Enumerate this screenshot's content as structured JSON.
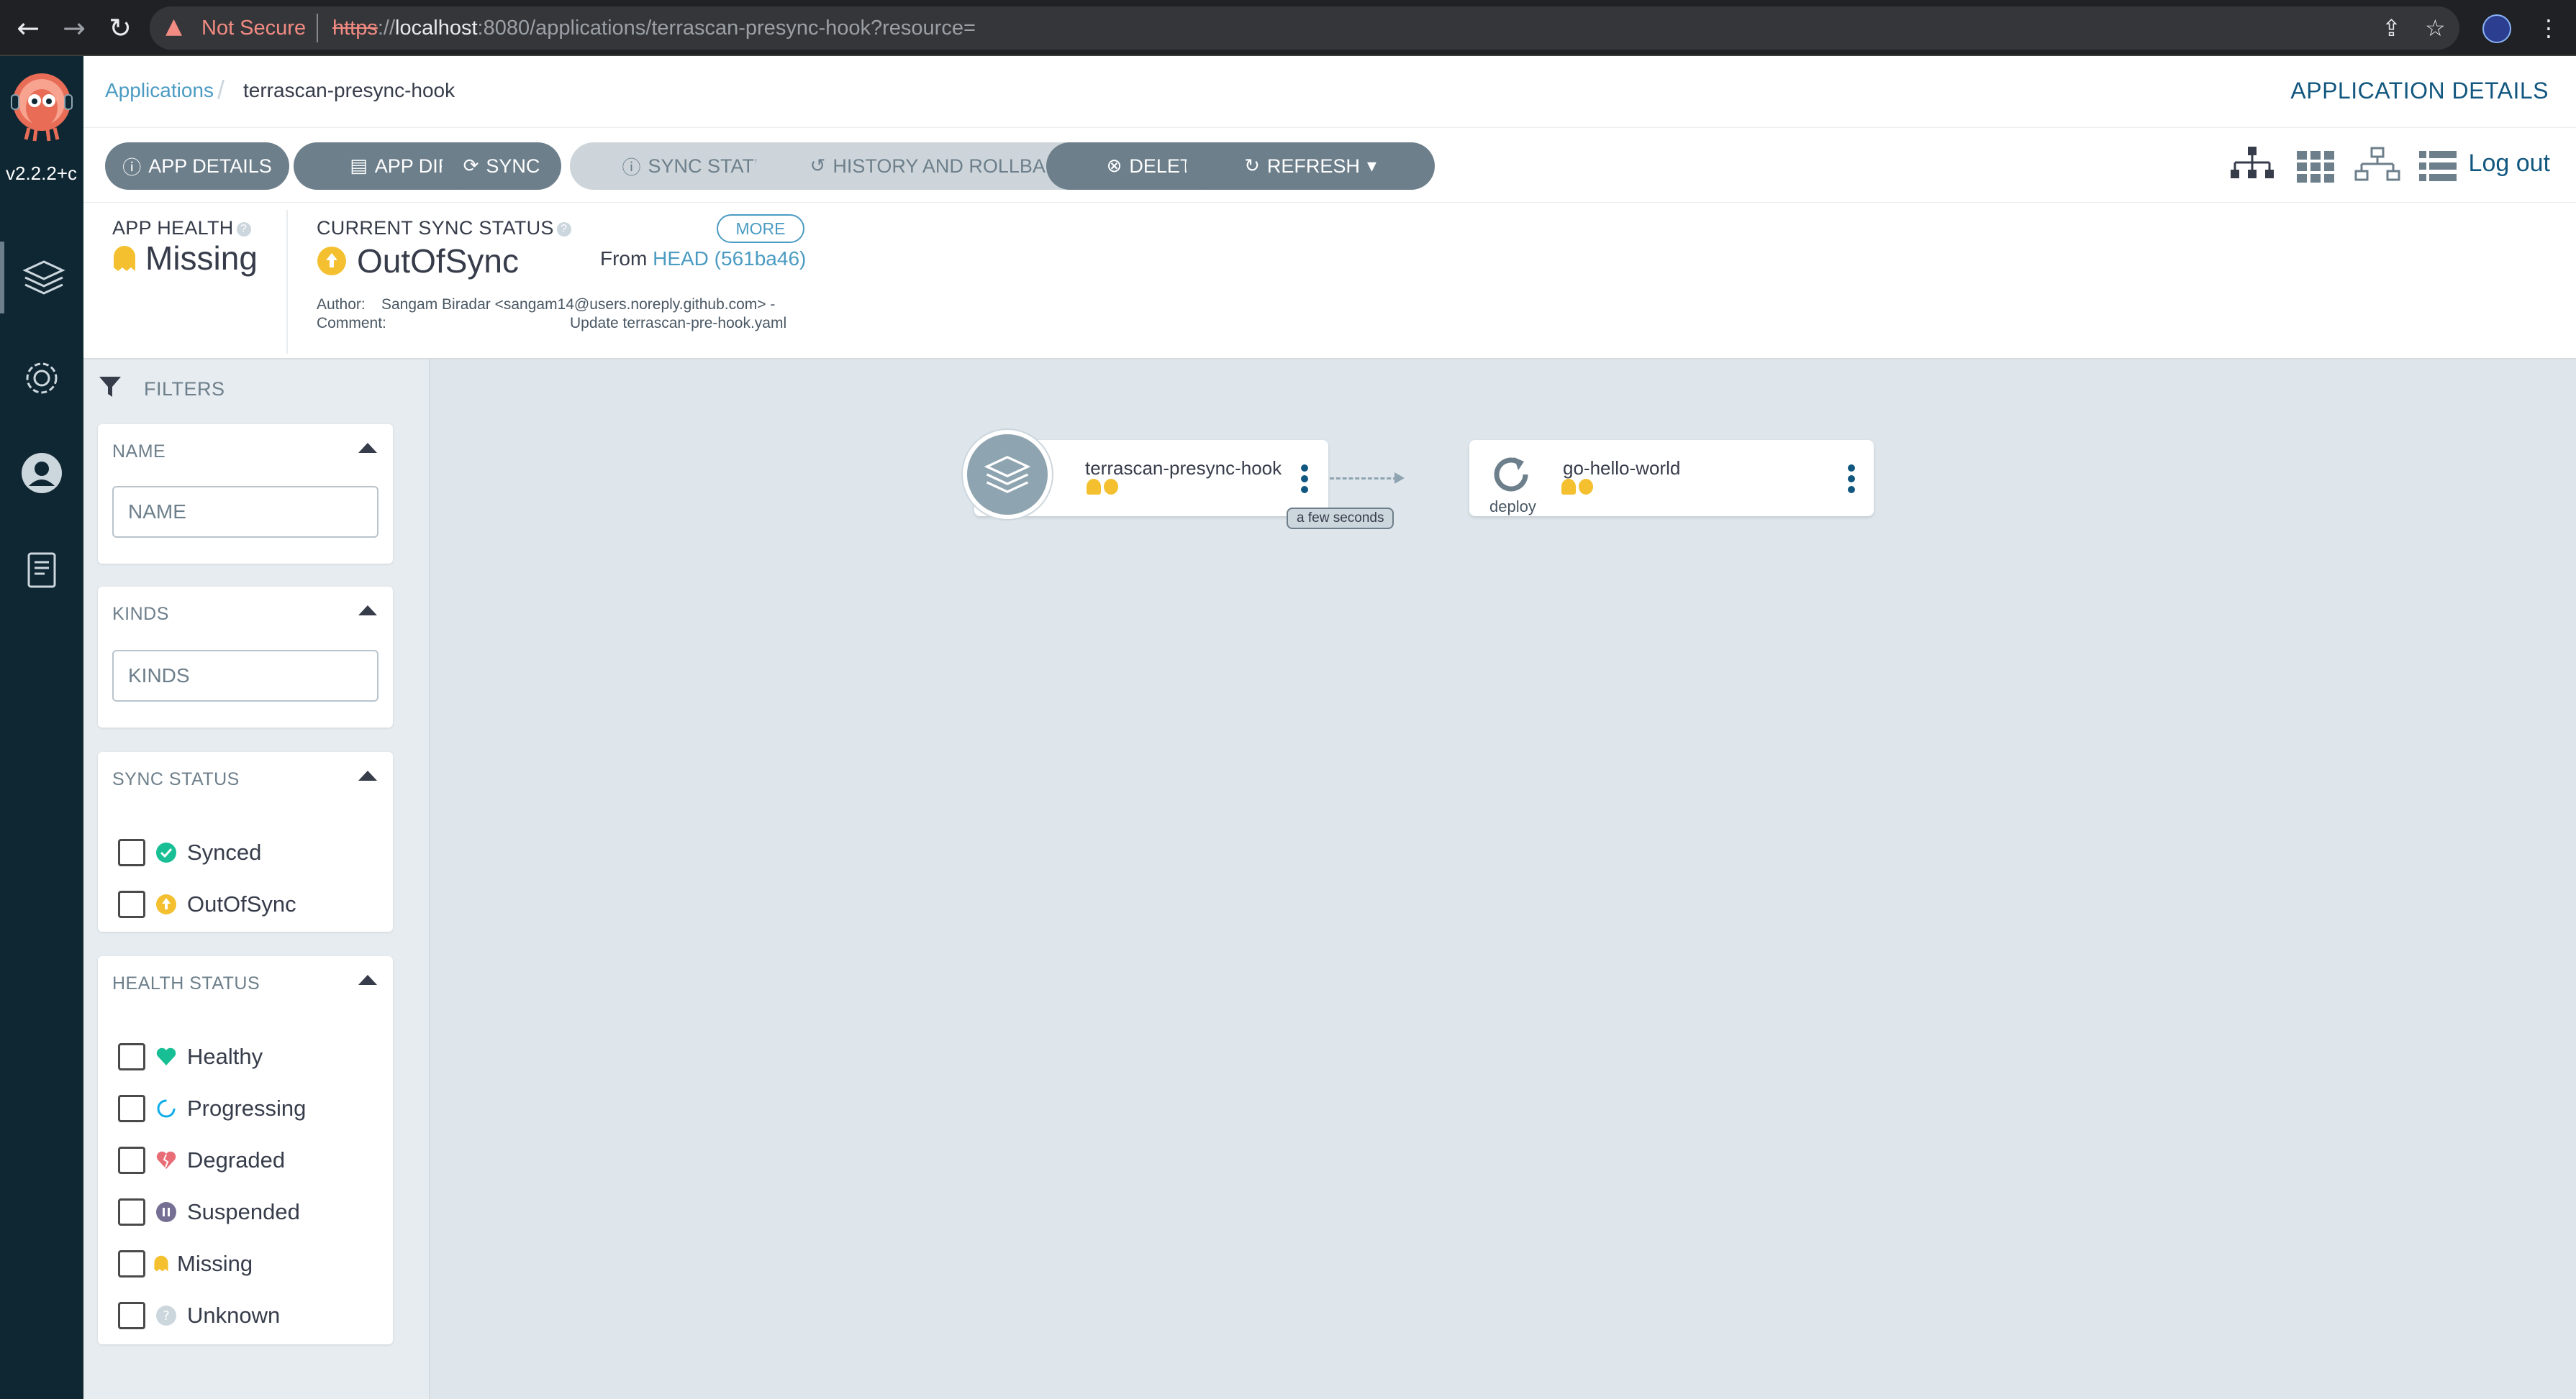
{
  "browser": {
    "not_secure": "Not Secure",
    "url_scheme": "https",
    "url_host": "localhost",
    "url_rest": ":8080/applications/terrascan-presync-hook?resource=",
    "url_sep": "://"
  },
  "nav": {
    "version": "v2.2.2+c",
    "items": [
      "applications-icon",
      "settings-icon",
      "user-info-icon",
      "docs-icon"
    ]
  },
  "header": {
    "breadcrumb_root": "Applications",
    "breadcrumb_current": "terrascan-presync-hook",
    "title": "APPLICATION DETAILS"
  },
  "toolbar": {
    "app_details": "APP DETAILS",
    "app_diff": "APP DIFF",
    "sync": "SYNC",
    "sync_status": "SYNC STATUS",
    "history": "HISTORY AND ROLLBACK",
    "delete": "DELETE",
    "refresh": "REFRESH",
    "logout": "Log out"
  },
  "status": {
    "health_label": "APP HEALTH",
    "health_value": "Missing",
    "sync_label": "CURRENT SYNC STATUS",
    "sync_value": "OutOfSync",
    "more": "MORE",
    "from_prefix": "From",
    "revision": "HEAD (561ba46)",
    "author_label": "Author:",
    "author_value": "Sangam Biradar <sangam14@users.noreply.github.com> -",
    "comment_label": "Comment:",
    "comment_value": "Update terrascan-pre-hook.yaml"
  },
  "filters": {
    "title": "FILTERS",
    "name_title": "NAME",
    "name_placeholder": "NAME",
    "kinds_title": "KINDS",
    "kinds_placeholder": "KINDS",
    "sync_title": "SYNC STATUS",
    "sync_options": [
      "Synced",
      "OutOfSync"
    ],
    "health_title": "HEALTH STATUS",
    "health_options": [
      "Healthy",
      "Progressing",
      "Degraded",
      "Suspended",
      "Missing",
      "Unknown"
    ]
  },
  "graph": {
    "app_node": {
      "name": "terrascan-presync-hook",
      "age": "a few seconds"
    },
    "resource_node": {
      "name": "go-hello-world",
      "kind": "deploy"
    }
  },
  "colors": {
    "accent": "#12577f",
    "link": "#4b9bc2",
    "button": "#6d7f8b",
    "missing": "#f4c030",
    "healthy": "#18be94",
    "degraded": "#e96d76"
  }
}
